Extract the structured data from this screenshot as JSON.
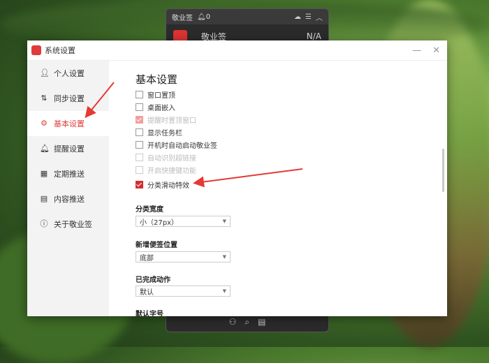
{
  "widget": {
    "title": "敬业签",
    "bell_count": "0",
    "row_name": "敬业签",
    "row_value": "N/A"
  },
  "window": {
    "title": "系统设置",
    "minimize": "—",
    "close": "✕"
  },
  "sidebar": {
    "items": [
      {
        "label": "个人设置",
        "icon": "person-icon"
      },
      {
        "label": "同步设置",
        "icon": "sync-icon"
      },
      {
        "label": "基本设置",
        "icon": "gear-icon",
        "active": true
      },
      {
        "label": "提醒设置",
        "icon": "bell-icon"
      },
      {
        "label": "定期推送",
        "icon": "calendar-icon"
      },
      {
        "label": "内容推送",
        "icon": "document-icon"
      },
      {
        "label": "关于敬业签",
        "icon": "info-icon"
      }
    ]
  },
  "basic": {
    "title": "基本设置",
    "options": [
      {
        "label": "窗口置顶",
        "checked": false,
        "disabled": false
      },
      {
        "label": "桌面嵌入",
        "checked": false,
        "disabled": false
      },
      {
        "label": "提醒时置顶窗口",
        "checked": true,
        "disabled": true
      },
      {
        "label": "显示任务栏",
        "checked": false,
        "disabled": false
      },
      {
        "label": "开机时自动启动敬业签",
        "checked": false,
        "disabled": false
      },
      {
        "label": "自动识别超链接",
        "checked": false,
        "disabled": true
      },
      {
        "label": "开启快捷键功能",
        "checked": false,
        "disabled": true
      },
      {
        "label": "分类滑动特效",
        "checked": true,
        "disabled": false
      }
    ],
    "category_width": {
      "label": "分类宽度",
      "value": "小（27px）"
    },
    "new_note_position": {
      "label": "新增便签位置",
      "value": "底部"
    },
    "completed_action": {
      "label": "已完成动作",
      "value": "默认"
    },
    "default_font": {
      "label": "默认字号"
    }
  },
  "colors": {
    "accent": "#e23b3b",
    "arrow": "#e53935"
  }
}
